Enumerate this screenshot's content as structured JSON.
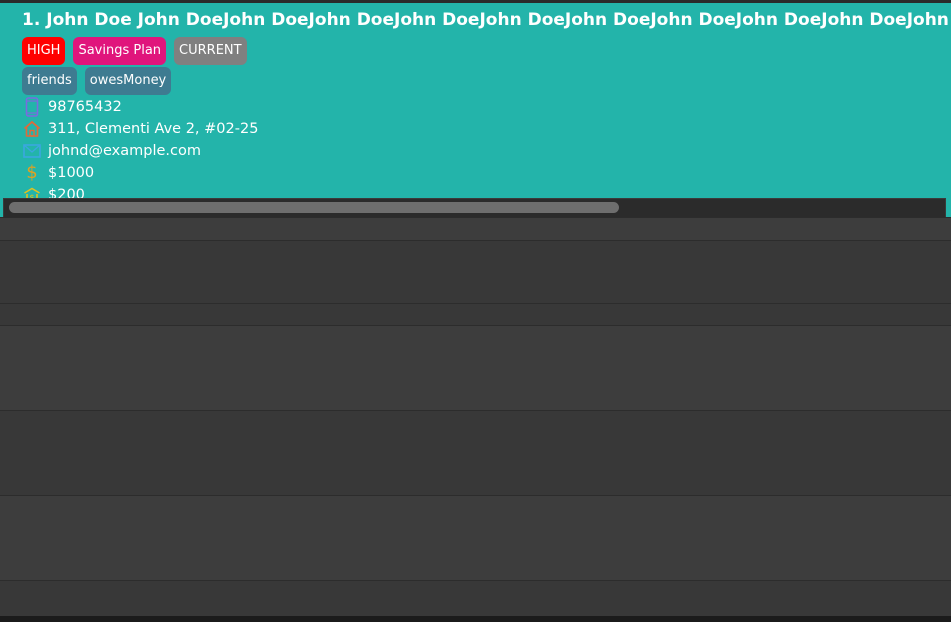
{
  "person": {
    "index": "1.",
    "name": "John Doe John DoeJohn DoeJohn DoeJohn DoeJohn DoeJohn DoeJohn DoeJohn DoeJohn DoeJohn DoeJohn",
    "priority_tags": [
      {
        "label": "HIGH",
        "color": "#ff0000"
      },
      {
        "label": "Savings Plan",
        "color": "#e0157c"
      },
      {
        "label": "CURRENT",
        "color": "#808080"
      }
    ],
    "tags": [
      {
        "label": "friends",
        "color": "#3e7b91"
      },
      {
        "label": "owesMoney",
        "color": "#3e7b91"
      }
    ],
    "phone": "98765432",
    "address": "311, Clementi Ave 2, #02-25",
    "email": "johnd@example.com",
    "income": "$1000",
    "savings": "$200"
  },
  "icons": {
    "phone": "phone-icon",
    "address": "home-icon",
    "email": "mail-icon",
    "income": "dollar-icon",
    "savings": "bank-icon"
  },
  "colors": {
    "card_background": "#23b4aa",
    "list_background": "#383838"
  }
}
